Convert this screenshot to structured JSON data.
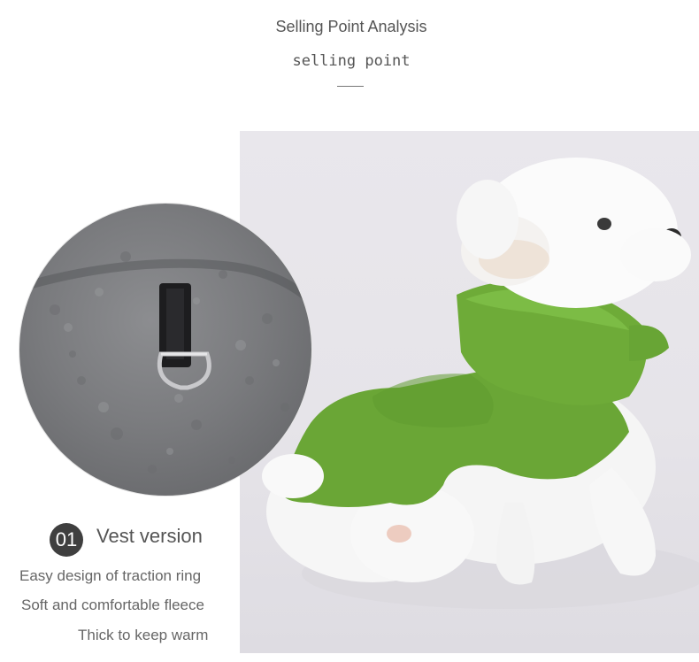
{
  "header": {
    "title": "Selling Point Analysis",
    "subtitle": "selling point",
    "dash": "——"
  },
  "feature": {
    "number": "01",
    "title": "Vest version",
    "points": [
      "Easy design of traction ring",
      "Soft and comfortable fleece",
      "Thick to keep warm"
    ]
  },
  "colors": {
    "fleece_green": "#6aa636",
    "fleece_gray": "#7a7b7e",
    "badge": "#3f3f3f"
  }
}
